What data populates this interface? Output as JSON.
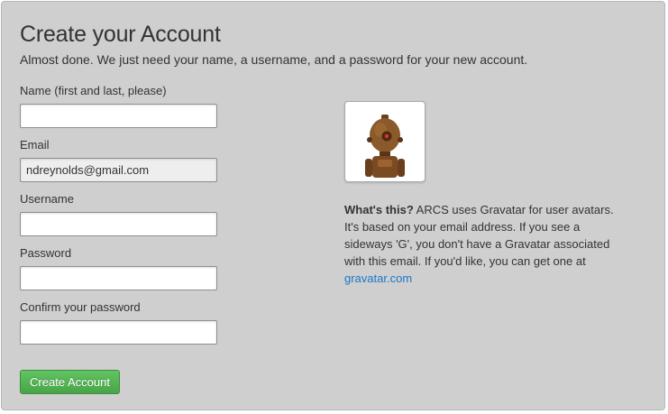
{
  "page": {
    "title": "Create your Account",
    "subtitle": "Almost done. We just need your name, a username, and a password for your new account."
  },
  "form": {
    "fields": [
      {
        "label": "Name (first and last, please)",
        "value": ""
      },
      {
        "label": "Email",
        "value": "ndreynolds@gmail.com"
      },
      {
        "label": "Username",
        "value": ""
      },
      {
        "label": "Password",
        "value": ""
      },
      {
        "label": "Confirm your password",
        "value": ""
      }
    ],
    "submit_label": "Create Account"
  },
  "gravatar": {
    "avatar_icon": "robot-avatar-icon",
    "help_heading": "What's this?",
    "help_body": " ARCS uses Gravatar for user avatars. It's based on your email address. If you see a sideways 'G', you don't have a Gravatar associated with this email. If you'd like, you can get one at ",
    "link_text": "gravatar.com"
  },
  "colors": {
    "panel_background": "#cfcfcf",
    "button_green": "#5bb75b",
    "link_blue": "#1a78c9"
  }
}
